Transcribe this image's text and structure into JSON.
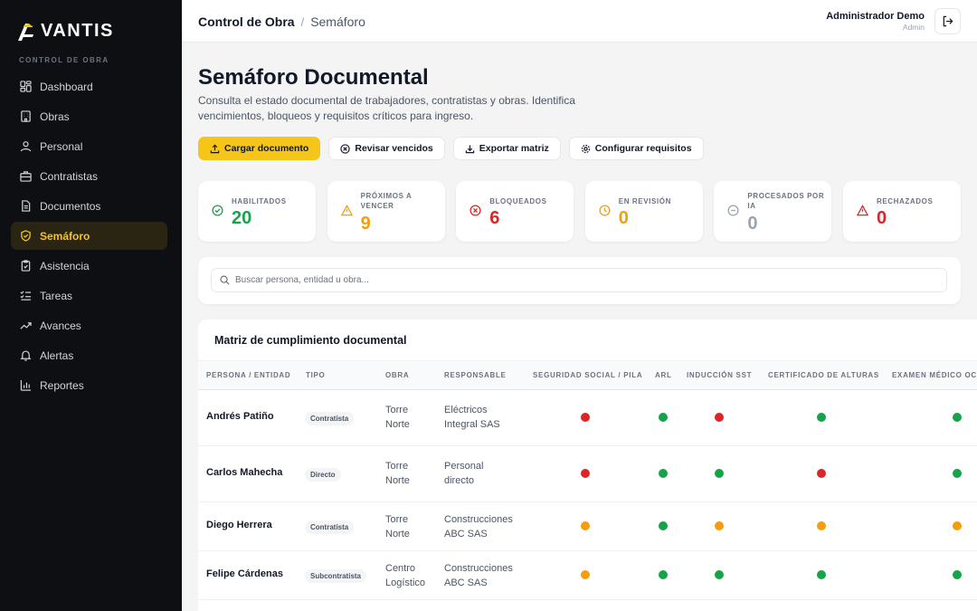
{
  "brand": {
    "name": "VANTIS",
    "accent": "#f5c518"
  },
  "sidebar": {
    "section_label": "CONTROL DE OBRA",
    "items": [
      {
        "label": "Dashboard",
        "icon": "dashboard-icon"
      },
      {
        "label": "Obras",
        "icon": "building-icon"
      },
      {
        "label": "Personal",
        "icon": "user-icon"
      },
      {
        "label": "Contratistas",
        "icon": "briefcase-icon"
      },
      {
        "label": "Documentos",
        "icon": "document-icon"
      },
      {
        "label": "Semáforo",
        "icon": "shield-icon",
        "active": true
      },
      {
        "label": "Asistencia",
        "icon": "clipboard-icon"
      },
      {
        "label": "Tareas",
        "icon": "list-checks-icon"
      },
      {
        "label": "Avances",
        "icon": "trending-up-icon"
      },
      {
        "label": "Alertas",
        "icon": "bell-icon"
      },
      {
        "label": "Reportes",
        "icon": "bar-chart-icon"
      }
    ]
  },
  "header": {
    "breadcrumb": [
      "Control de Obra",
      "Semáforo"
    ],
    "user_name": "Administrador Demo",
    "user_role": "Admin"
  },
  "page": {
    "title": "Semáforo Documental",
    "subtitle": "Consulta el estado documental de trabajadores, contratistas y obras. Identifica vencimientos, bloqueos y requisitos críticos para ingreso."
  },
  "actions": {
    "upload": "Cargar documento",
    "review": "Revisar vencidos",
    "export": "Exportar matriz",
    "configure": "Configurar requisitos"
  },
  "stats": [
    {
      "label": "HABILITADOS",
      "value": "20",
      "color": "#16a34a",
      "icon": "check-circle-icon"
    },
    {
      "label": "PRÓXIMOS A VENCER",
      "value": "9",
      "color": "#f59e0b",
      "icon": "warning-icon"
    },
    {
      "label": "BLOQUEADOS",
      "value": "6",
      "color": "#dc2626",
      "icon": "x-circle-icon"
    },
    {
      "label": "EN REVISIÓN",
      "value": "0",
      "color": "#f59e0b",
      "icon": "clock-icon"
    },
    {
      "label": "PROCESADOS POR IA",
      "value": "0",
      "color": "#9ca3af",
      "icon": "minus-circle-icon"
    },
    {
      "label": "RECHAZADOS",
      "value": "0",
      "color": "#dc2626",
      "icon": "alert-triangle-icon"
    }
  ],
  "search": {
    "placeholder": "Buscar persona, entidad u obra..."
  },
  "matrix": {
    "title": "Matriz de cumplimiento documental",
    "columns": [
      "PERSONA / ENTIDAD",
      "TIPO",
      "OBRA",
      "RESPONSABLE",
      "SEGURIDAD SOCIAL / PILA",
      "ARL",
      "INDUCCIÓN SST",
      "CERTIFICADO DE ALTURAS",
      "EXAMEN MÉDICO OCU"
    ],
    "status_colors": {
      "green": "#16a34a",
      "red": "#dc2626",
      "amber": "#f59e0b"
    },
    "rows": [
      {
        "name": "Andrés Patiño",
        "tipo": "Contratista",
        "obra": [
          "Torre",
          "Norte"
        ],
        "responsable": [
          "Eléctricos",
          "Integral SAS"
        ],
        "status": [
          "red",
          "green",
          "red",
          "green",
          "green"
        ]
      },
      {
        "name": "Carlos Mahecha",
        "tipo": "Directo",
        "obra": [
          "Torre",
          "Norte"
        ],
        "responsable": [
          "Personal",
          "directo"
        ],
        "status": [
          "red",
          "green",
          "green",
          "red",
          "green"
        ]
      },
      {
        "name": "Diego Herrera",
        "tipo": "Contratista",
        "obra": [
          "Torre",
          "Norte"
        ],
        "responsable": [
          "Construcciones",
          "ABC SAS"
        ],
        "status": [
          "amber",
          "green",
          "amber",
          "amber",
          "amber"
        ]
      },
      {
        "name": "Felipe Cárdenas",
        "tipo": "Subcontratista",
        "obra": [
          "Centro",
          "Logístico"
        ],
        "responsable": [
          "Construcciones",
          "ABC SAS"
        ],
        "status": [
          "amber",
          "green",
          "green",
          "green",
          "green"
        ]
      }
    ]
  }
}
